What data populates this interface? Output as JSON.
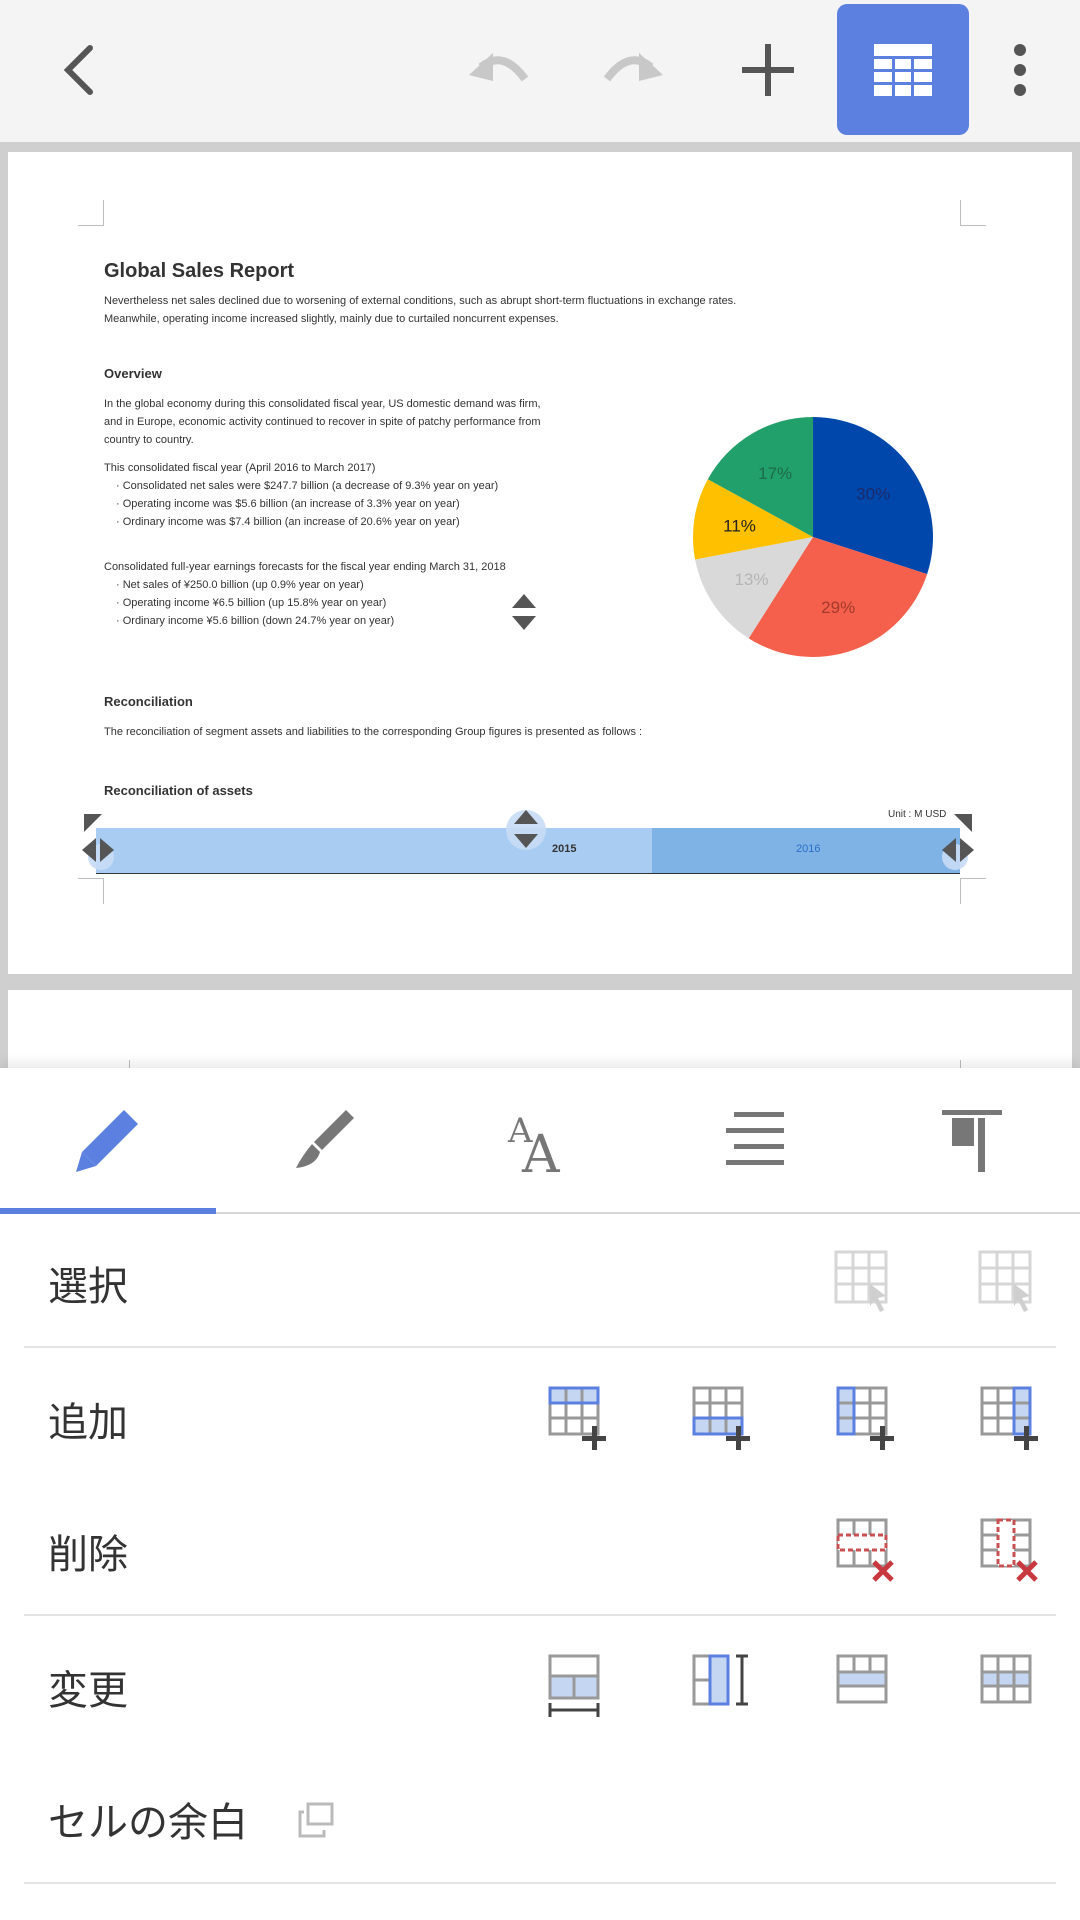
{
  "toolbar": {
    "icons": [
      "back-arrow-icon",
      "undo-icon",
      "redo-icon",
      "plus-icon",
      "table-icon",
      "more-vertical-icon"
    ],
    "accent": "#5b80e0"
  },
  "document": {
    "title": "Global Sales Report",
    "intro": [
      "Nevertheless net sales declined due to worsening of external conditions, such as abrupt short-term fluctuations in exchange rates.",
      "Meanwhile, operating income increased slightly, mainly due to curtailed noncurrent expenses."
    ],
    "overview_heading": "Overview",
    "overview_para": [
      "In the global economy during this consolidated fiscal year, US domestic demand was firm,",
      "and in Europe, economic activity continued to recover in spite of patchy performance from",
      "country to country."
    ],
    "fiscal_lines": [
      "This consolidated fiscal year (April 2016 to March 2017)",
      "· Consolidated net sales were $247.7 billion (a decrease of 9.3% year on year)",
      "· Operating income was $5.6 billion (an increase of 3.3% year on year)",
      "· Ordinary income was $7.4 billion (an increase of 20.6% year on year)"
    ],
    "forecast_lines": [
      "Consolidated full-year earnings forecasts for the fiscal year ending March 31, 2018",
      "· Net sales of ¥250.0 billion (up 0.9% year on year)",
      "· Operating income ¥6.5 billion (up 15.8% year on year)",
      "· Ordinary income ¥5.6 billion (down 24.7% year on year)"
    ],
    "reconciliation_heading": "Reconciliation",
    "reconciliation_para": "The reconciliation of segment assets and liabilities to the corresponding Group figures is presented as follows :",
    "assets_heading": "Reconciliation of assets",
    "unit_label": "Unit : M USD",
    "table_headers": [
      "2015",
      "2016"
    ]
  },
  "chart_data": {
    "type": "pie",
    "slices": [
      {
        "label": "30%",
        "value": 30,
        "color": "#0047ab"
      },
      {
        "label": "29%",
        "value": 29,
        "color": "#f4604c"
      },
      {
        "label": "13%",
        "value": 13,
        "color": "#d9d9d9"
      },
      {
        "label": "11%",
        "value": 11,
        "color": "#ffc000"
      },
      {
        "label": "17%",
        "value": 17,
        "color": "#22a06b"
      }
    ]
  },
  "format_tabs": [
    {
      "name": "edit-tab",
      "icon": "pencil-icon",
      "active": true
    },
    {
      "name": "style-tab",
      "icon": "brush-icon",
      "active": false
    },
    {
      "name": "font-tab",
      "icon": "font-size-icon",
      "active": false
    },
    {
      "name": "paragraph-tab",
      "icon": "align-icon",
      "active": false
    },
    {
      "name": "layout-tab",
      "icon": "paragraph-mark-icon",
      "active": false
    }
  ],
  "table_menu": {
    "select_label": "選択",
    "add_label": "追加",
    "delete_label": "削除",
    "change_label": "変更",
    "cell_margin_label": "セルの余白"
  }
}
